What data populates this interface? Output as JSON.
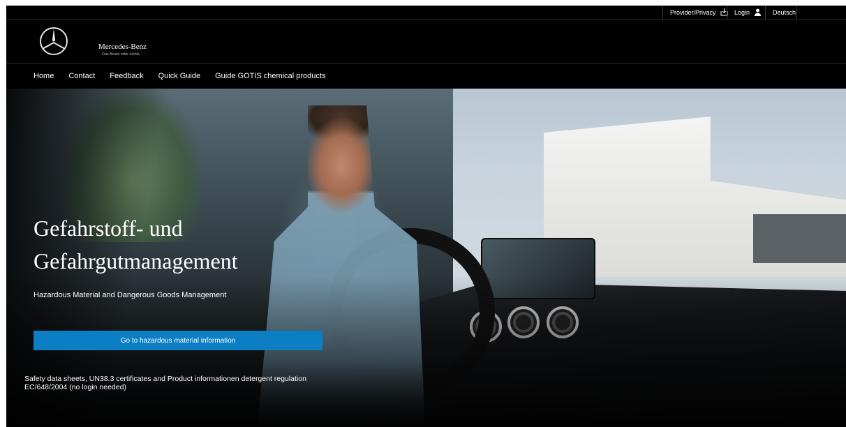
{
  "utility": {
    "provider_privacy": "Provider/Privacy",
    "login": "Login",
    "language": "Deutsch"
  },
  "brand": {
    "name": "Mercedes-Benz",
    "slogan": "Das Beste oder nichts."
  },
  "nav": {
    "items": [
      "Home",
      "Contact",
      "Feedback",
      "Quick Guide",
      "Guide GOTIS chemical products"
    ]
  },
  "hero": {
    "title_line1": "Gefahrstoff- und",
    "title_line2": "Gefahrgutmanagement",
    "subtitle": "Hazardous Material and Dangerous Goods Management",
    "cta_label": "Go to hazardous material information",
    "note_line1": "Safety data sheets, UN38.3 certificates and Product informationen detergent regulation",
    "note_line2": "EC/648/2004 (no login needed)"
  },
  "colors": {
    "header_bg": "#000000",
    "cta_bg": "#0c7fc4",
    "text": "#ffffff"
  },
  "icons": [
    "download-icon",
    "user-icon",
    "mercedes-star-icon"
  ]
}
